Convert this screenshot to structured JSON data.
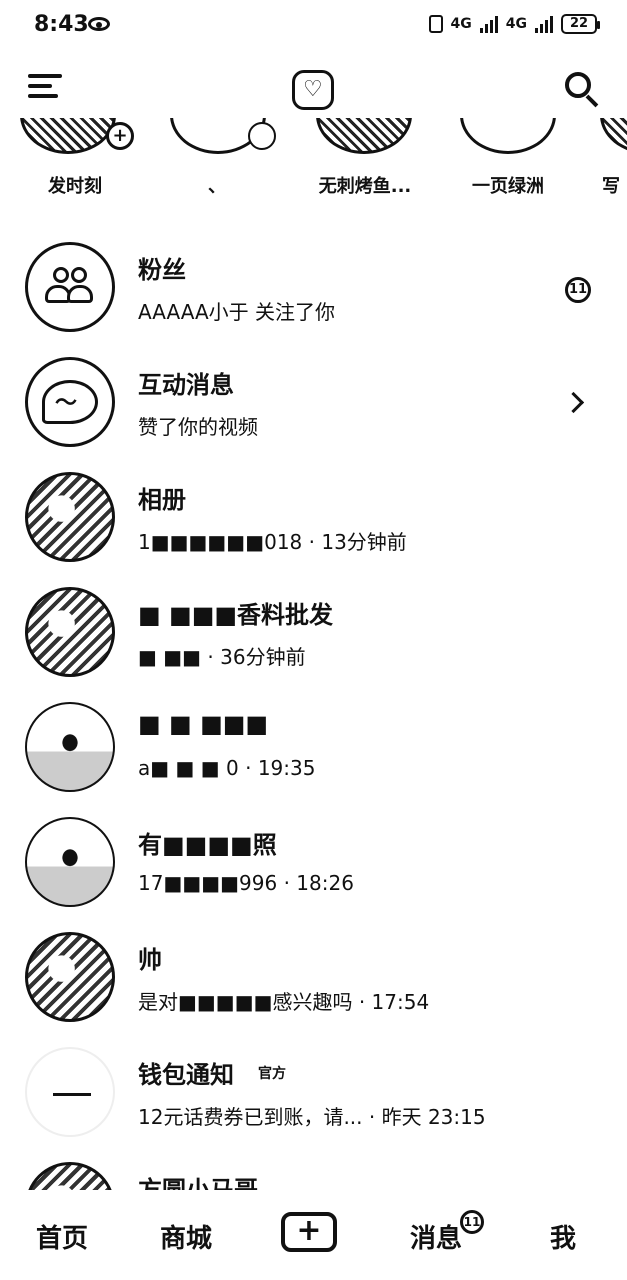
{
  "status_bar": {
    "time": "8:43",
    "network_1": "4G",
    "network_2": "4G",
    "battery": "22"
  },
  "top_bar": {
    "icons": [
      "menu-icon",
      "camera-heart-icon",
      "search-icon"
    ]
  },
  "stories": [
    {
      "label": "发时刻",
      "style": "pattern",
      "badge": "plus"
    },
    {
      "label": "、",
      "style": "light",
      "badge": "ring"
    },
    {
      "label": "无刺烤鱼...",
      "style": "pattern",
      "badge": "none"
    },
    {
      "label": "一页绿洲",
      "style": "light",
      "badge": "none"
    },
    {
      "label": "写",
      "style": "pattern",
      "badge": "none"
    }
  ],
  "messages": [
    {
      "title": "粉丝",
      "subtitle": "AAAAA小于 关注了你",
      "badge": "11",
      "avatar_icon": "people-icon"
    },
    {
      "title": "互动消息",
      "subtitle": "赞了你的视频",
      "avatar_icon": "chat-bolt-icon",
      "chevron": true
    },
    {
      "title": "相册",
      "subtitle": "1■■■■■■018 · 13分钟前"
    },
    {
      "title": "■ ■■■香料批发",
      "subtitle": "■ ■■ · 36分钟前"
    },
    {
      "title": "■ ■ ■■■",
      "subtitle": "a■ ■ ■ 0 · 19:35"
    },
    {
      "title": "有■■■■照",
      "subtitle": "17■■■■996 · 18:26"
    },
    {
      "title": "帅",
      "subtitle": "是对■■■■■感兴趣吗 · 17:54"
    },
    {
      "title": "钱包通知",
      "tag": "官方",
      "subtitle": "12元话费券已到账，请... · 昨天 23:15"
    },
    {
      "title": "方圆小马哥",
      "subtitle": ""
    }
  ],
  "bottom_nav": {
    "home": "首页",
    "mall": "商城",
    "add": "+",
    "messages": "消息",
    "messages_badge": "11",
    "me": "我"
  },
  "colors": {
    "text": "#111111",
    "background": "#ffffff"
  }
}
